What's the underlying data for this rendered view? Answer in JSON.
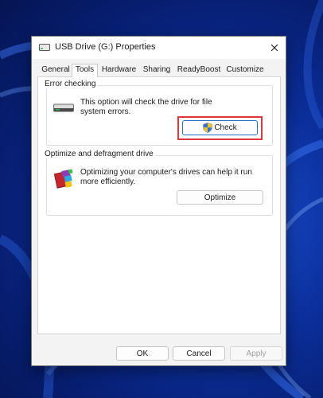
{
  "window": {
    "title": "USB Drive (G:) Properties"
  },
  "tabs": [
    {
      "label": "General",
      "active": false
    },
    {
      "label": "Tools",
      "active": true
    },
    {
      "label": "Hardware",
      "active": false
    },
    {
      "label": "Sharing",
      "active": false
    },
    {
      "label": "ReadyBoost",
      "active": false
    },
    {
      "label": "Customize",
      "active": false
    }
  ],
  "error_checking": {
    "heading": "Error checking",
    "description_line1": "This option will check the drive for file",
    "description_line2": "system errors.",
    "check_button": "Check",
    "drive_icon": "drive-icon",
    "shield_icon": "uac-shield-icon"
  },
  "optimize": {
    "heading": "Optimize and defragment drive",
    "description_line1": "Optimizing your computer's drives can help it run",
    "description_line2": "more efficiently.",
    "optimize_button": "Optimize",
    "icon": "defrag-icon"
  },
  "footer": {
    "ok": "OK",
    "cancel": "Cancel",
    "apply": "Apply"
  },
  "colors": {
    "highlight": "#e0353b",
    "desktop": "#0b2f9c",
    "focus": "#1f6fc5"
  }
}
